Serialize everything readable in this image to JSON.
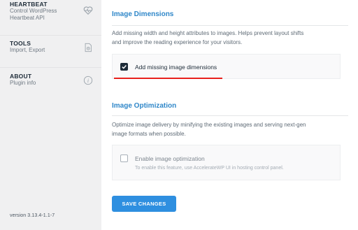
{
  "sidebar": {
    "items": [
      {
        "title": "HEARTBEAT",
        "sub1": "Control WordPress",
        "sub2": "Heartbeat API",
        "icon": "heart-pulse-icon"
      },
      {
        "title": "TOOLS",
        "sub1": "Import, Export",
        "icon": "document-gear-icon"
      },
      {
        "title": "ABOUT",
        "sub1": "Plugin info",
        "icon": "info-icon"
      }
    ],
    "version": "version 3.13.4-1.1-7"
  },
  "image_dimensions": {
    "title": "Image Dimensions",
    "desc1": "Add missing width and height attributes to images. Helps prevent layout shifts",
    "desc2": "and improve the reading experience for your visitors.",
    "option_label": "Add missing image dimensions",
    "checked": true
  },
  "image_optimization": {
    "title": "Image Optimization",
    "desc1": "Optimize image delivery by minifying the existing images and serving next-gen",
    "desc2": "image formats when possible.",
    "option_label": "Enable image optimization",
    "option_hint": "To enable this feature, use AccelerateWP UI in hosting control panel.",
    "checked": false
  },
  "actions": {
    "save_label": "SAVE CHANGES"
  },
  "colors": {
    "accent": "#2f87c9",
    "button": "#2e8fe0",
    "annotation": "#e8201c"
  }
}
